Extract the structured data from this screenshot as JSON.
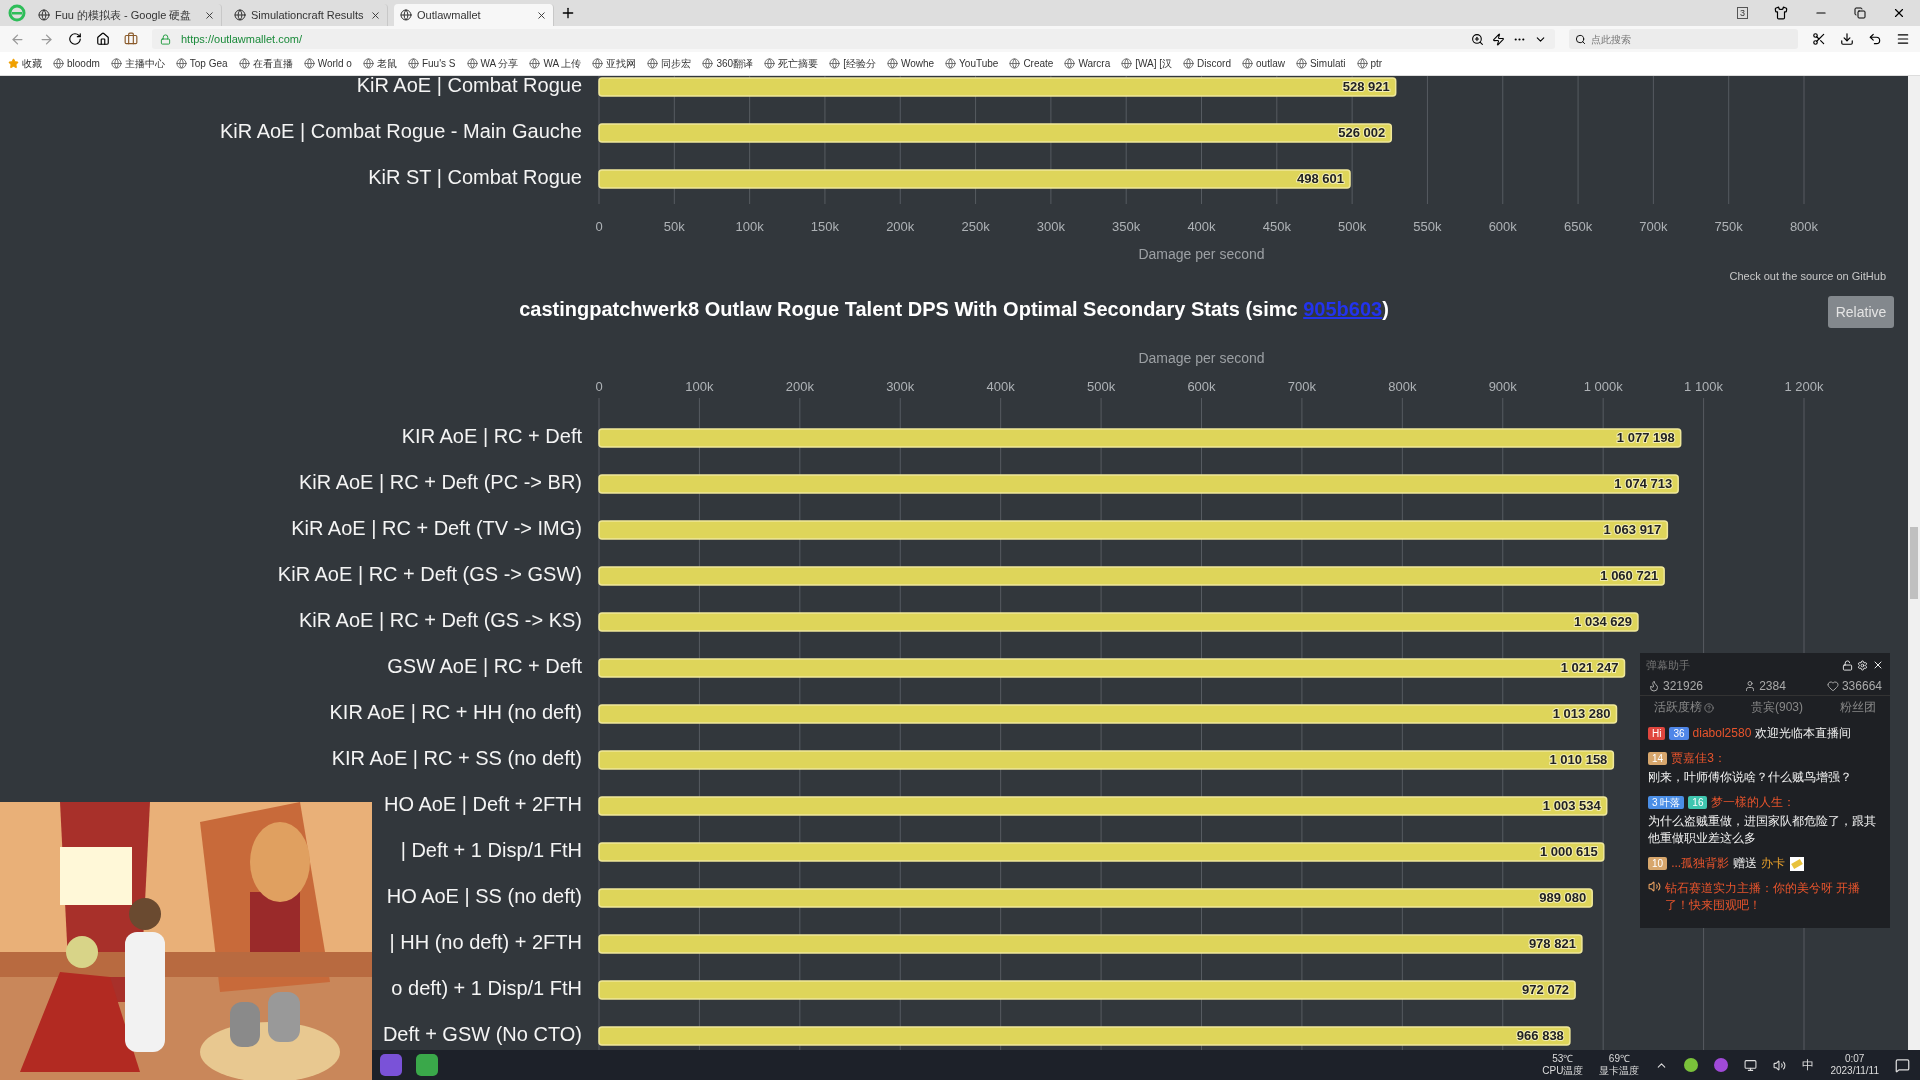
{
  "browser": {
    "tabs": [
      {
        "title": "Fuu 的模拟表 - Google 硬盘",
        "selected": false
      },
      {
        "title": "Simulationcraft Results",
        "selected": false
      },
      {
        "title": "Outlawmallet",
        "selected": true
      }
    ],
    "tab_count": "3",
    "url": "https://outlawmallet.com/",
    "search": {
      "placeholder": "点此搜索"
    },
    "bookmarks": [
      "收藏",
      "bloodm",
      "主播中心",
      "Top Gea",
      "在看直播",
      "World o",
      "老鼠",
      "Fuu's S",
      "WA 分享",
      "WA 上传",
      "亚找网",
      "同步宏",
      "360翻译",
      "死亡摘要",
      "[经验分",
      "Wowhe",
      "YouTube",
      "Create",
      "Warcra",
      "[WA] [汉",
      "Discord",
      "outlaw",
      "Simulati",
      "ptr"
    ]
  },
  "chart_top": {
    "chart_data": {
      "type": "bar",
      "orientation": "horizontal",
      "grid": true,
      "xlabel": "Damage per second",
      "categories": [
        "KiR AoE | Combat Rogue",
        "KiR AoE | Combat Rogue - Main Gauche",
        "KiR ST | Combat Rogue"
      ],
      "values": [
        528921,
        526002,
        498601
      ],
      "value_labels": [
        "528 921",
        "526 002",
        "498 601"
      ],
      "xlim": [
        0,
        800000
      ],
      "xticks": [
        0,
        {
          "value": 50000,
          "label": "50k"
        },
        {
          "value": 100000,
          "label": "100k"
        },
        {
          "value": 150000,
          "label": "150k"
        },
        {
          "value": 200000,
          "label": "200k"
        },
        {
          "value": 250000,
          "label": "250k"
        },
        {
          "value": 300000,
          "label": "300k"
        },
        {
          "value": 350000,
          "label": "350k"
        },
        {
          "value": 400000,
          "label": "400k"
        },
        {
          "value": 450000,
          "label": "450k"
        },
        {
          "value": 500000,
          "label": "500k"
        },
        {
          "value": 550000,
          "label": "550k"
        },
        {
          "value": 600000,
          "label": "600k"
        },
        {
          "value": 650000,
          "label": "650k"
        },
        {
          "value": 700000,
          "label": "700k"
        },
        {
          "value": 750000,
          "label": "750k"
        },
        {
          "value": 800000,
          "label": "800k"
        }
      ]
    }
  },
  "source_link": "Check out the source on GitHub",
  "chart_main": {
    "title": "castingpatchwerk8 Outlaw Rogue Talent DPS With Optimal Secondary Stats (simc ",
    "commit_link": "905b603",
    "title_end": ")",
    "relative_button": "Relative",
    "chart_data": {
      "type": "bar",
      "orientation": "horizontal",
      "grid": true,
      "xlabel": "Damage per second",
      "categories": [
        "KIR AoE | RC + Deft",
        "KiR AoE | RC + Deft (PC -> BR)",
        "KiR AoE | RC + Deft (TV -> IMG)",
        "KiR AoE | RC + Deft (GS -> GSW)",
        "KiR AoE | RC + Deft (GS -> KS)",
        "GSW AoE | RC + Deft",
        "KIR AoE | RC + HH (no deft)",
        "KIR AoE | RC + SS (no deft)",
        "HO AoE | Deft + 2FTH",
        "| Deft + 1 Disp/1 FtH",
        "HO AoE | SS (no deft)",
        "| HH (no deft) + 2FTH",
        "o deft) + 1 Disp/1 FtH",
        "Deft + GSW (No CTO)"
      ],
      "values": [
        1077198,
        1074713,
        1063917,
        1060721,
        1034629,
        1021247,
        1013280,
        1010158,
        1003534,
        1000615,
        989080,
        978821,
        972072,
        966838
      ],
      "value_labels": [
        "1 077 198",
        "1 074 713",
        "1 063 917",
        "1 060 721",
        "1 034 629",
        "1 021 247",
        "1 013 280",
        "1 010 158",
        "1 003 534",
        "1 000 615",
        "989 080",
        "978 821",
        "972 072",
        "966 838"
      ],
      "xlim": [
        0,
        1200000
      ],
      "xticks": [
        0,
        {
          "value": 100000,
          "label": "100k"
        },
        {
          "value": 200000,
          "label": "200k"
        },
        {
          "value": 300000,
          "label": "300k"
        },
        {
          "value": 400000,
          "label": "400k"
        },
        {
          "value": 500000,
          "label": "500k"
        },
        {
          "value": 600000,
          "label": "600k"
        },
        {
          "value": 700000,
          "label": "700k"
        },
        {
          "value": 800000,
          "label": "800k"
        },
        {
          "value": 900000,
          "label": "900k"
        },
        {
          "value": 1000000,
          "label": "1 000k"
        },
        {
          "value": 1100000,
          "label": "1 100k"
        },
        {
          "value": 1200000,
          "label": "1 200k"
        }
      ]
    }
  },
  "chat": {
    "title": "弹幕助手",
    "stats": [
      {
        "kind": "hot",
        "value": "321926"
      },
      {
        "kind": "viewers",
        "value": "2384"
      },
      {
        "kind": "likes",
        "value": "336664"
      }
    ],
    "tabs": [
      {
        "label": "活跃度榜",
        "help": true
      },
      {
        "label": "贵宾(903)",
        "help": false
      },
      {
        "label": "粉丝团",
        "help": false
      }
    ],
    "messages": [
      {
        "kind": "chat",
        "badges": [
          {
            "text": "Hi",
            "color": "#e0463e"
          },
          {
            "text": "36",
            "color": "#4f86e8"
          }
        ],
        "user": "diabol2580",
        "text": "欢迎光临本直播间"
      },
      {
        "kind": "chat",
        "badges": [
          {
            "text": "14",
            "color": "#d7a66c"
          }
        ],
        "user": "贾嘉佳3：",
        "text": "刚来，叶师傅你说啥？什么贼鸟增强？"
      },
      {
        "kind": "chat",
        "badges": [
          {
            "level": "3",
            "text": "叶落",
            "color": "#4a8ee6"
          },
          {
            "text": "16",
            "color": "#3fc6b0"
          }
        ],
        "user": "梦一樣的人生：",
        "text": "为什么盗贼重做，进国家队都危险了，跟其他重做职业差这么多"
      },
      {
        "kind": "gift",
        "badges": [
          {
            "text": "10",
            "color": "#d7a66c"
          }
        ],
        "user": "...孤独背影",
        "text": "赠送",
        "gift": "办卡"
      },
      {
        "kind": "system",
        "text": "钻石赛道实力主播：你的美兮呀 开播了！快来围观吧！"
      }
    ]
  },
  "taskbar": {
    "cpu_temp": "53℃",
    "cpu_label": "CPU温度",
    "gpu_temp": "69℃",
    "gpu_label": "显卡温度",
    "ime": "中",
    "time": "0:07",
    "date": "2023/11/11"
  }
}
